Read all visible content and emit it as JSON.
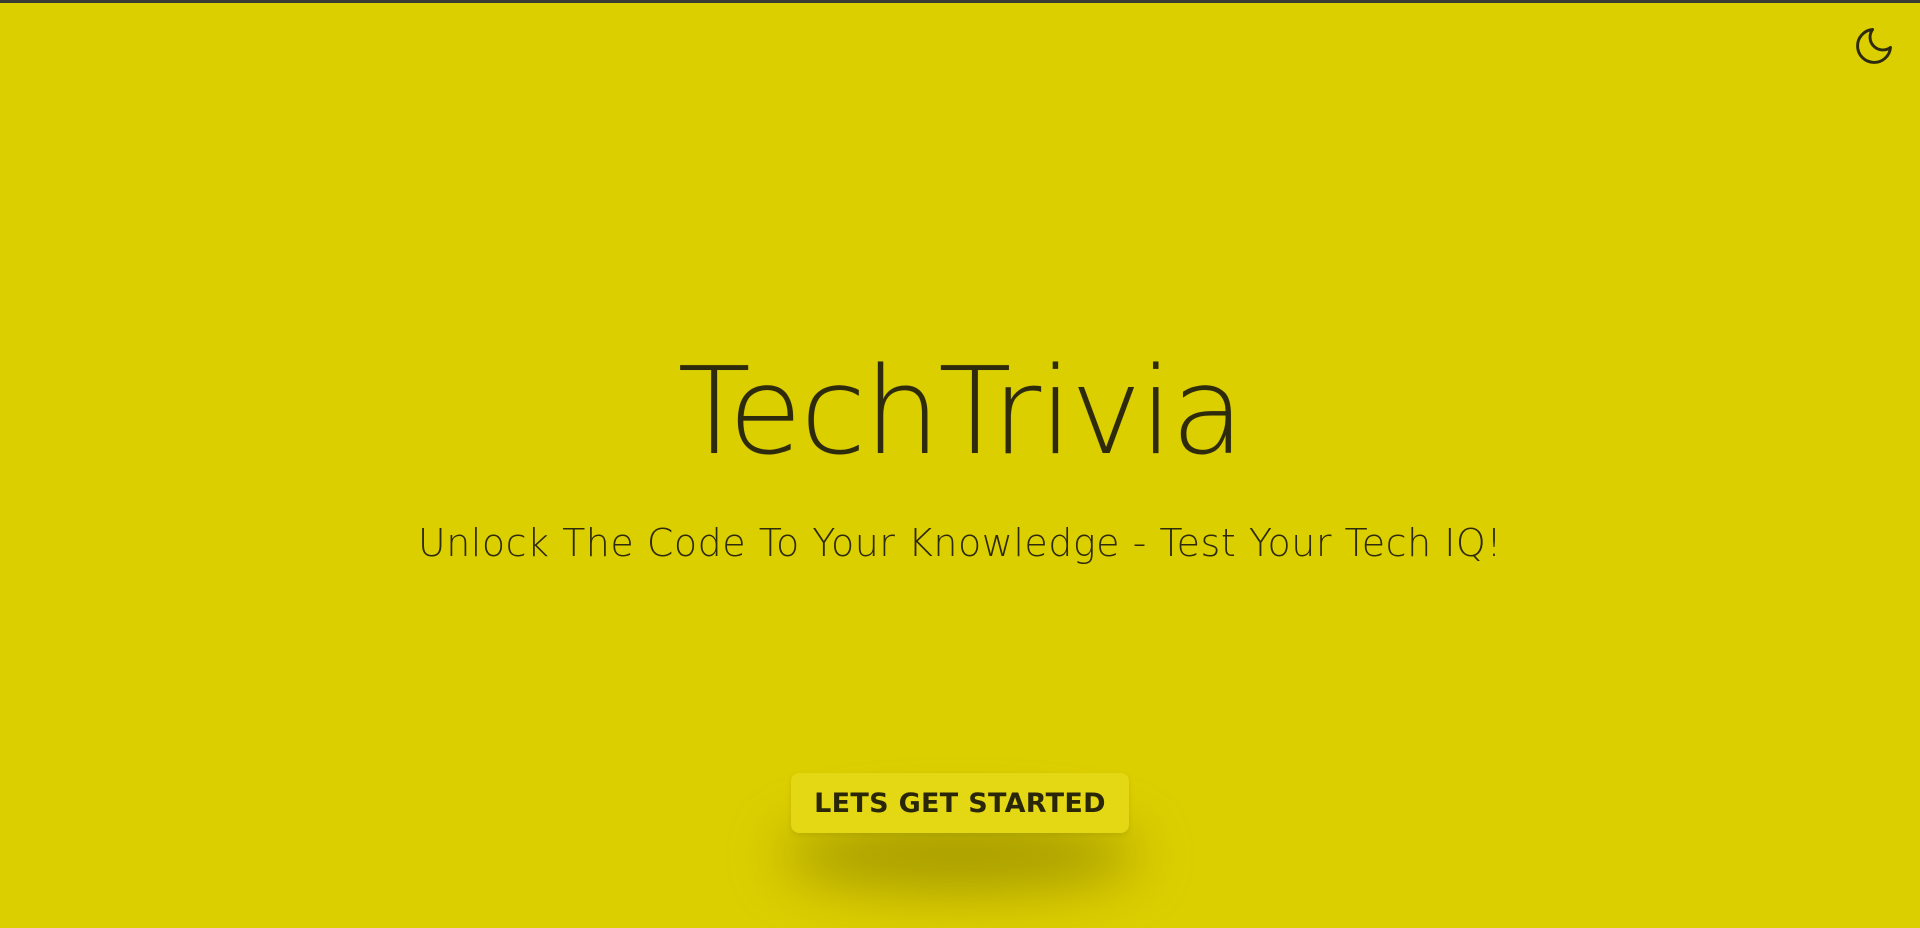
{
  "header": {
    "theme_toggle_icon": "moon-icon"
  },
  "hero": {
    "title": "TechTrivia",
    "subtitle": "Unlock The Code To Your Knowledge - Test Your Tech IQ!",
    "cta_label": "LETS GET STARTED"
  },
  "colors": {
    "background": "#dccf00",
    "text": "#2e2a0c",
    "button": "#e4d713"
  }
}
